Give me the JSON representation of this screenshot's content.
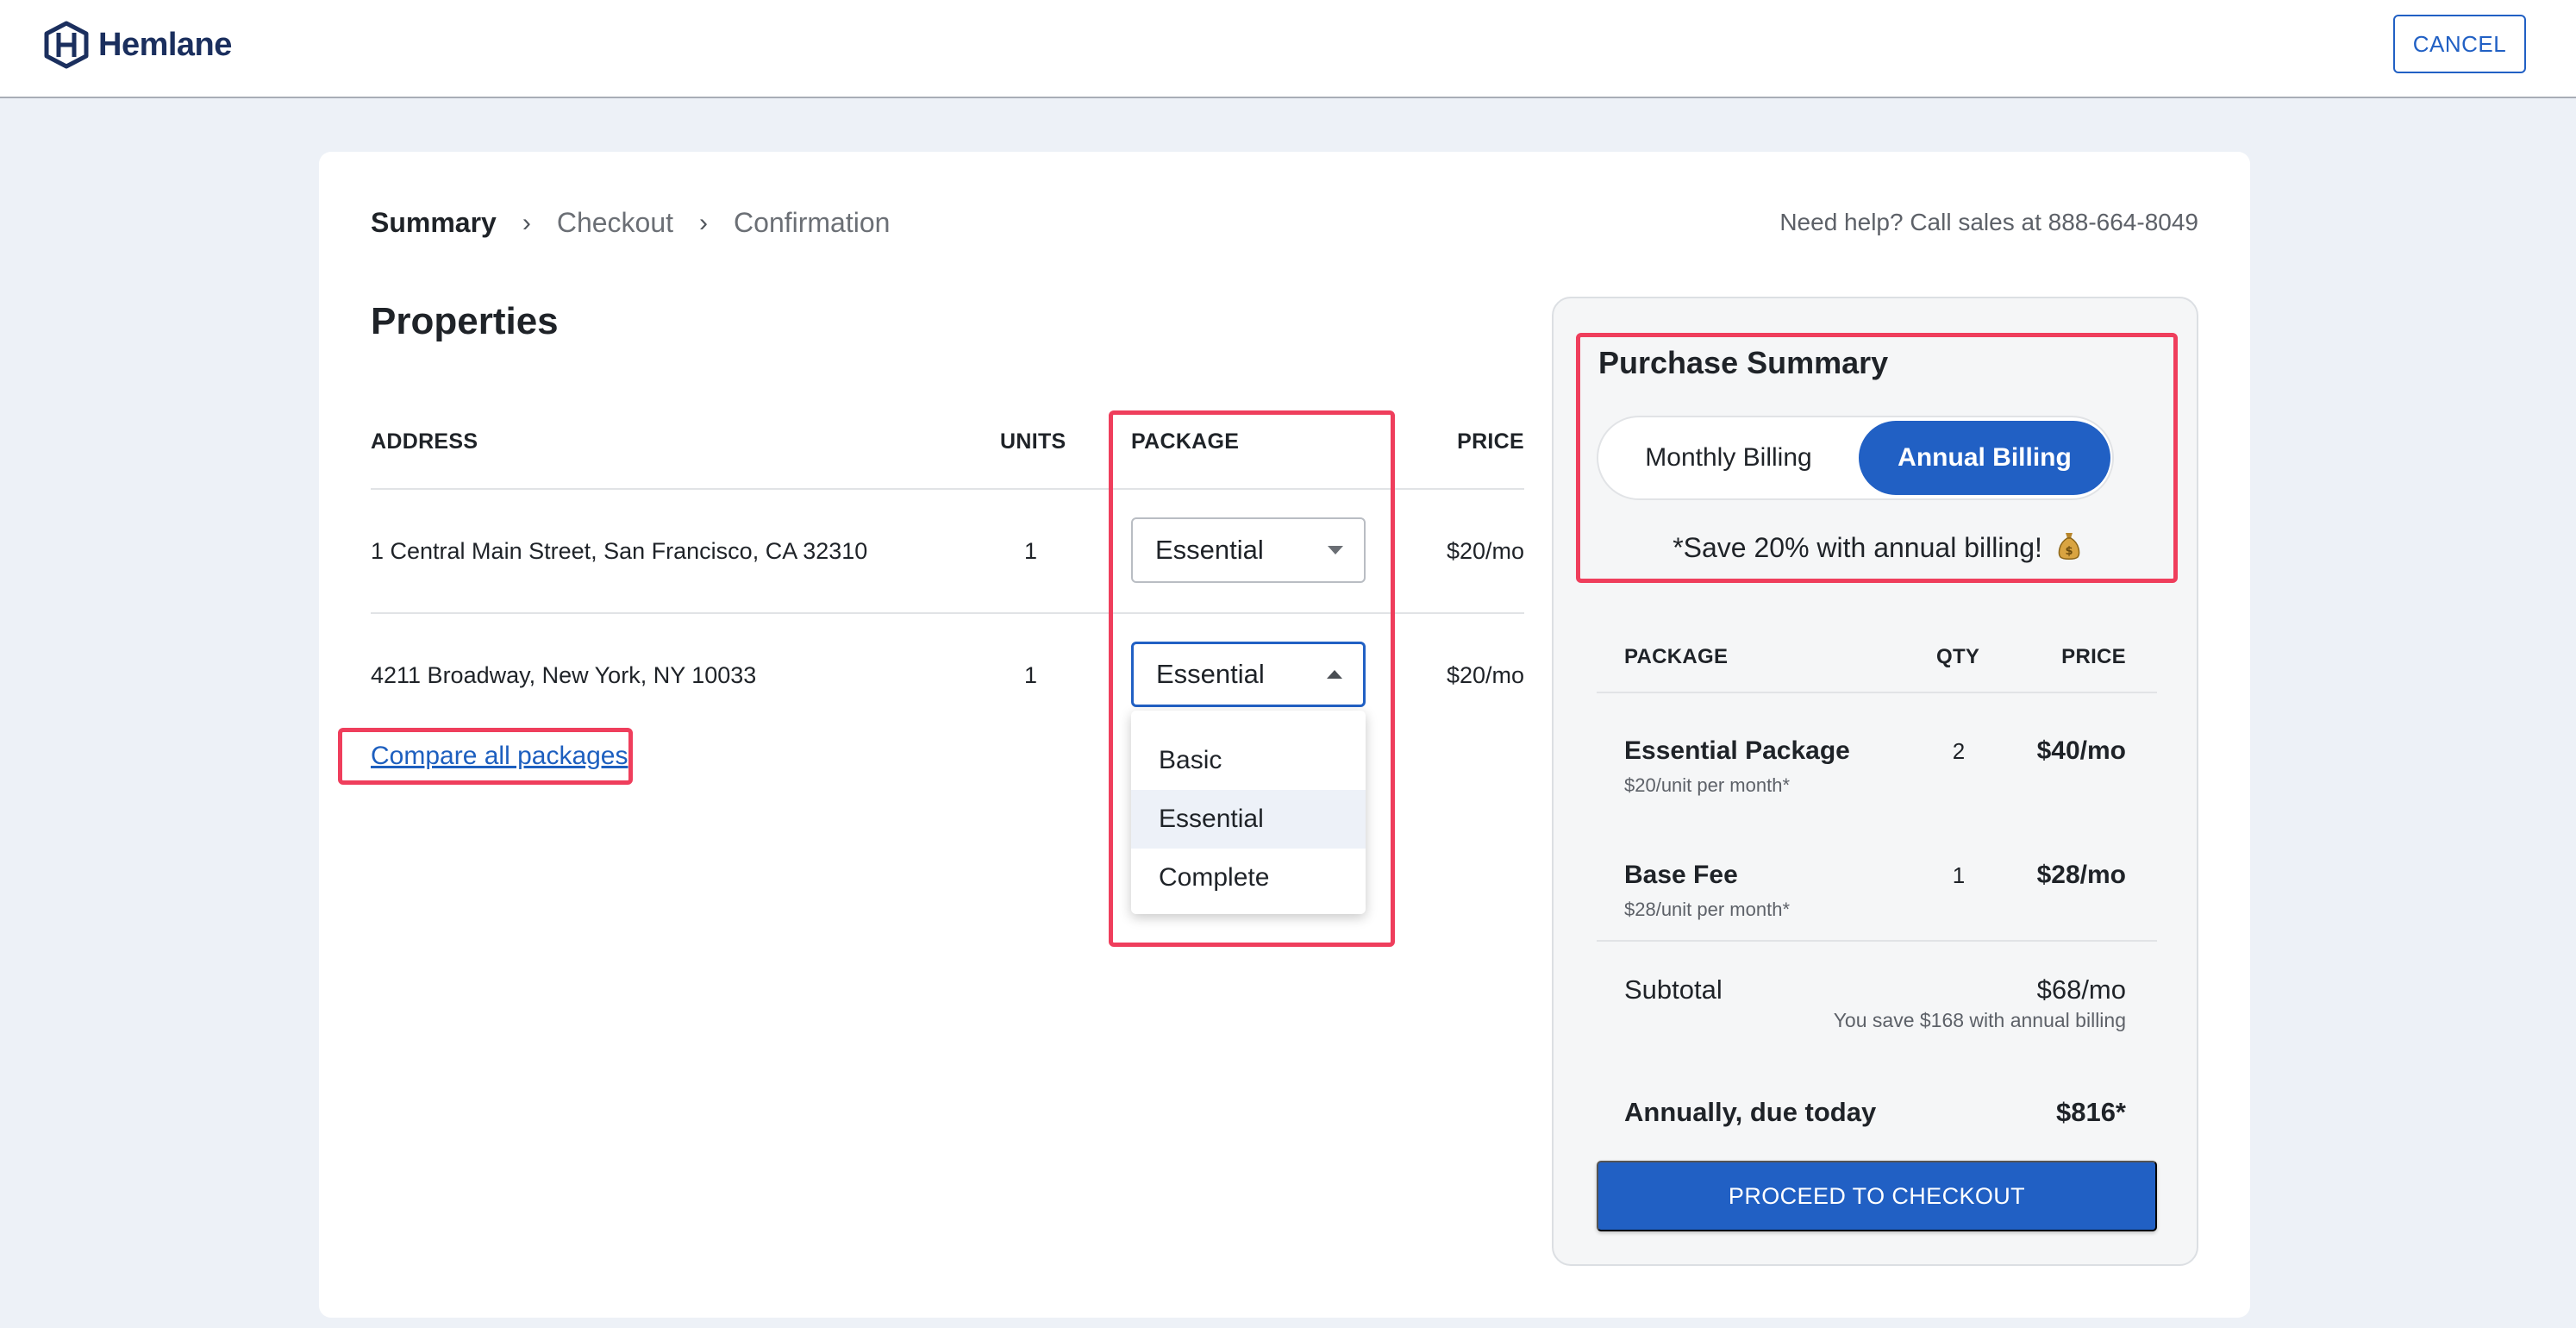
{
  "header": {
    "logo_text": "Hemlane",
    "cancel_label": "CANCEL"
  },
  "breadcrumb": {
    "items": [
      "Summary",
      "Checkout",
      "Confirmation"
    ],
    "separator": "›"
  },
  "help_text": "Need help? Call sales at 888-664-8049",
  "properties": {
    "title": "Properties",
    "columns": [
      "ADDRESS",
      "UNITS",
      "PACKAGE",
      "PRICE"
    ],
    "rows": [
      {
        "address": "1 Central Main Street, San Francisco, CA 32310",
        "units": "1",
        "package": "Essential",
        "price": "$20/mo"
      },
      {
        "address": "4211 Broadway, New York, NY 10033",
        "units": "1",
        "package": "Essential",
        "price": "$20/mo"
      }
    ],
    "compare_link": "Compare all packages"
  },
  "package_dropdown": {
    "options": [
      "Basic",
      "Essential",
      "Complete"
    ],
    "selected": "Essential"
  },
  "summary": {
    "title": "Purchase Summary",
    "billing_options": [
      "Monthly Billing",
      "Annual Billing"
    ],
    "active_billing": "Annual Billing",
    "save_note": "*Save 20% with annual billing!",
    "columns": [
      "PACKAGE",
      "QTY",
      "PRICE"
    ],
    "items": [
      {
        "name": "Essential Package",
        "sub": "$20/unit per month*",
        "qty": "2",
        "price": "$40/mo"
      },
      {
        "name": "Base Fee",
        "sub": "$28/unit per month*",
        "qty": "1",
        "price": "$28/mo"
      }
    ],
    "subtotal_label": "Subtotal",
    "subtotal_price": "$68/mo",
    "savings_note": "You save $168 with annual billing",
    "annual_label": "Annually, due today",
    "annual_price": "$816*",
    "checkout_label": "PROCEED TO CHECKOUT"
  },
  "colors": {
    "brand": "#1b2f5e",
    "primary": "#2160c4",
    "highlight": "#ef3e5c",
    "background": "#edf1f7"
  }
}
